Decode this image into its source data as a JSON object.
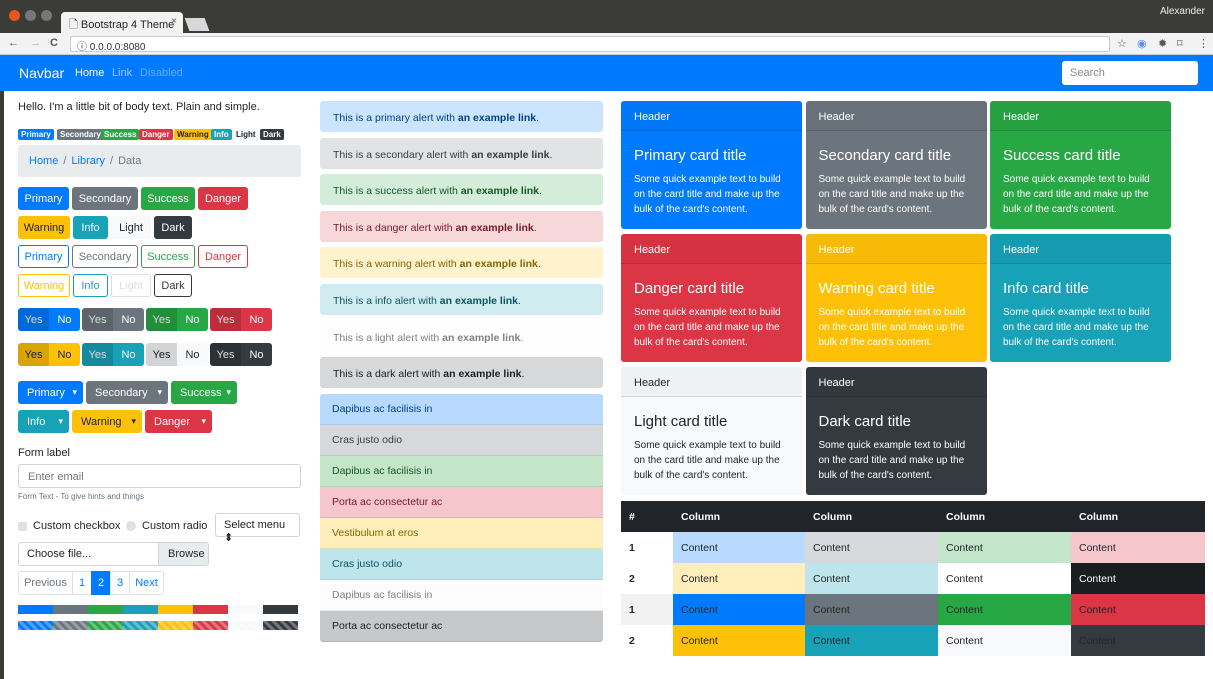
{
  "browser": {
    "tab_title": "Bootstrap 4 Theme",
    "tab_close": "×",
    "user": "Alexander",
    "url": "0.0.0.0:8080",
    "back": "←",
    "forward": "→",
    "reload": "C",
    "info": "ⓘ",
    "star": "☆"
  },
  "navbar": {
    "brand": "Navbar",
    "links": [
      {
        "label": "Home",
        "color": "#ffffff"
      },
      {
        "label": "Link",
        "color": "#9cc8ff"
      },
      {
        "label": "Disabled",
        "color": "#66adff"
      }
    ],
    "search_placeholder": "Search",
    "bg": "#007bff"
  },
  "col1": {
    "hello": "Hello. I'm a little bit of body text. Plain and simple.",
    "badges": [
      {
        "label": "Primary",
        "bg": "#007bff",
        "fg": "#fff"
      },
      {
        "label": "Secondary",
        "bg": "#6c757d",
        "fg": "#fff"
      },
      {
        "label": "Success",
        "bg": "#28a745",
        "fg": "#fff"
      },
      {
        "label": "Danger",
        "bg": "#dc3545",
        "fg": "#fff"
      },
      {
        "label": "Warning",
        "bg": "#ffc107",
        "fg": "#212529"
      },
      {
        "label": "Info",
        "bg": "#17a2b8",
        "fg": "#fff"
      },
      {
        "label": "Light",
        "bg": "#f8f9fa",
        "fg": "#212529"
      },
      {
        "label": "Dark",
        "bg": "#343a40",
        "fg": "#fff"
      }
    ],
    "breadcrumb": {
      "home": "Home",
      "library": "Library",
      "data": "Data",
      "sep": "/"
    },
    "buttons_row1": [
      "Primary",
      "Secondary",
      "Success",
      "Danger"
    ],
    "buttons_row2": [
      "Warning",
      "Info",
      "Light",
      "Dark"
    ],
    "outline_row1": [
      "Primary",
      "Secondary",
      "Success",
      "Danger"
    ],
    "outline_row2": [
      "Warning",
      "Info",
      "Light",
      "Dark"
    ],
    "yes": "Yes",
    "no": "No",
    "dropdowns_row1": [
      "Primary",
      "Secondary",
      "Success"
    ],
    "dropdowns_row2": [
      "Info",
      "Warning",
      "Danger"
    ],
    "caret": "▾",
    "form_label": "Form label",
    "email_placeholder": "Enter email",
    "form_hint": "Form Text - To give hints and things",
    "custom_checkbox": "Custom checkbox",
    "custom_radio": "Custom radio",
    "select_menu": "Select menu ⬍",
    "file_text": "Choose file...",
    "file_browse": "Browse",
    "pagination": [
      "Previous",
      "1",
      "2",
      "3",
      "Next"
    ]
  },
  "alerts": [
    {
      "pre": "This is a primary alert with ",
      "link": "an example link",
      "post": ".",
      "bg": "#cce5ff",
      "fg": "#004085"
    },
    {
      "pre": "This is a secondary alert with ",
      "link": "an example link",
      "post": ".",
      "bg": "#e2e3e5",
      "fg": "#383d41"
    },
    {
      "pre": "This is a success alert with ",
      "link": "an example link",
      "post": ".",
      "bg": "#d4edda",
      "fg": "#155724"
    },
    {
      "pre": "This is a danger alert with ",
      "link": "an example link",
      "post": ".",
      "bg": "#f8d7da",
      "fg": "#721c24"
    },
    {
      "pre": "This is a warning alert with ",
      "link": "an example link",
      "post": ".",
      "bg": "#fff3cd",
      "fg": "#856404"
    },
    {
      "pre": "This is a info alert with ",
      "link": "an example link",
      "post": ".",
      "bg": "#d1ecf1",
      "fg": "#0c5460"
    },
    {
      "pre": "This is a light alert with ",
      "link": "an example link",
      "post": ".",
      "bg": "#fefefe",
      "fg": "#818182"
    },
    {
      "pre": "This is a dark alert with ",
      "link": "an example link",
      "post": ".",
      "bg": "#d6d8d9",
      "fg": "#1b1e21"
    }
  ],
  "list_group": [
    {
      "label": "Dapibus ac facilisis in",
      "bg": "#b8daff",
      "fg": "#004085"
    },
    {
      "label": "Cras justo odio",
      "bg": "#d6d8db",
      "fg": "#383d41"
    },
    {
      "label": "Dapibus ac facilisis in",
      "bg": "#c3e6cb",
      "fg": "#155724"
    },
    {
      "label": "Porta ac consectetur ac",
      "bg": "#f5c6cb",
      "fg": "#721c24"
    },
    {
      "label": "Vestibulum at eros",
      "bg": "#ffeeba",
      "fg": "#856404"
    },
    {
      "label": "Cras justo odio",
      "bg": "#bee5eb",
      "fg": "#0c5460"
    },
    {
      "label": "Dapibus ac facilisis in",
      "bg": "#fdfdfe",
      "fg": "#818182"
    },
    {
      "label": "Porta ac consectetur ac",
      "bg": "#c6c8ca",
      "fg": "#1b1e21"
    }
  ],
  "cards": [
    {
      "header": "Header",
      "title": "Primary card title",
      "text": "Some quick example text to build on the card title and make up the bulk of the card's content.",
      "bg": "#007bff",
      "fg": "#ffffff"
    },
    {
      "header": "Header",
      "title": "Secondary card title",
      "text": "Some quick example text to build on the card title and make up the bulk of the card's content.",
      "bg": "#6c757d",
      "fg": "#ffffff"
    },
    {
      "header": "Header",
      "title": "Success card title",
      "text": "Some quick example text to build on the card title and make up the bulk of the card's content.",
      "bg": "#28a745",
      "fg": "#ffffff"
    },
    {
      "header": "Header",
      "title": "Danger card title",
      "text": "Some quick example text to build on the card title and make up the bulk of the card's content.",
      "bg": "#dc3545",
      "fg": "#ffffff"
    },
    {
      "header": "Header",
      "title": "Warning card title",
      "text": "Some quick example text to build on the card title and make up the bulk of the card's content.",
      "bg": "#ffc107",
      "fg": "#ffffff"
    },
    {
      "header": "Header",
      "title": "Info card title",
      "text": "Some quick example text to build on the card title and make up the bulk of the card's content.",
      "bg": "#17a2b8",
      "fg": "#ffffff"
    },
    {
      "header": "Header",
      "title": "Light card title",
      "text": "Some quick example text to build on the card title and make up the bulk of the card's content.",
      "bg": "#f8f9fa",
      "fg": "#212529"
    },
    {
      "header": "Header",
      "title": "Dark card title",
      "text": "Some quick example text to build on the card title and make up the bulk of the card's content.",
      "bg": "#343a40",
      "fg": "#ffffff"
    }
  ],
  "table": {
    "headers": [
      "#",
      "Column",
      "Column",
      "Column",
      "Column"
    ],
    "rows": [
      {
        "num": "1",
        "cells": [
          {
            "t": "Content",
            "bg": "#b8daff",
            "fg": "#212529"
          },
          {
            "t": "Content",
            "bg": "#d6d8db",
            "fg": "#212529"
          },
          {
            "t": "Content",
            "bg": "#c3e6cb",
            "fg": "#212529"
          },
          {
            "t": "Content",
            "bg": "#f5c6cb",
            "fg": "#212529"
          }
        ],
        "numbg": "#ffffff"
      },
      {
        "num": "2",
        "cells": [
          {
            "t": "Content",
            "bg": "#ffeeba",
            "fg": "#212529"
          },
          {
            "t": "Content",
            "bg": "#bee5eb",
            "fg": "#212529"
          },
          {
            "t": "Content",
            "bg": "#ffffff",
            "fg": "#212529"
          },
          {
            "t": "Content",
            "bg": "#1b1e21",
            "fg": "#ffffff"
          }
        ],
        "numbg": "#ffffff"
      },
      {
        "num": "1",
        "cells": [
          {
            "t": "Content",
            "bg": "#007bff",
            "fg": "#212529"
          },
          {
            "t": "Content",
            "bg": "#6c757d",
            "fg": "#212529"
          },
          {
            "t": "Content",
            "bg": "#28a745",
            "fg": "#212529"
          },
          {
            "t": "Content",
            "bg": "#dc3545",
            "fg": "#212529"
          }
        ],
        "numbg": "#f2f2f2"
      },
      {
        "num": "2",
        "cells": [
          {
            "t": "Content",
            "bg": "#ffc107",
            "fg": "#212529"
          },
          {
            "t": "Content",
            "bg": "#17a2b8",
            "fg": "#212529"
          },
          {
            "t": "Content",
            "bg": "#f8f9fa",
            "fg": "#212529"
          },
          {
            "t": "Content",
            "bg": "#343a40",
            "fg": "#212529"
          }
        ],
        "numbg": "#ffffff"
      }
    ]
  }
}
